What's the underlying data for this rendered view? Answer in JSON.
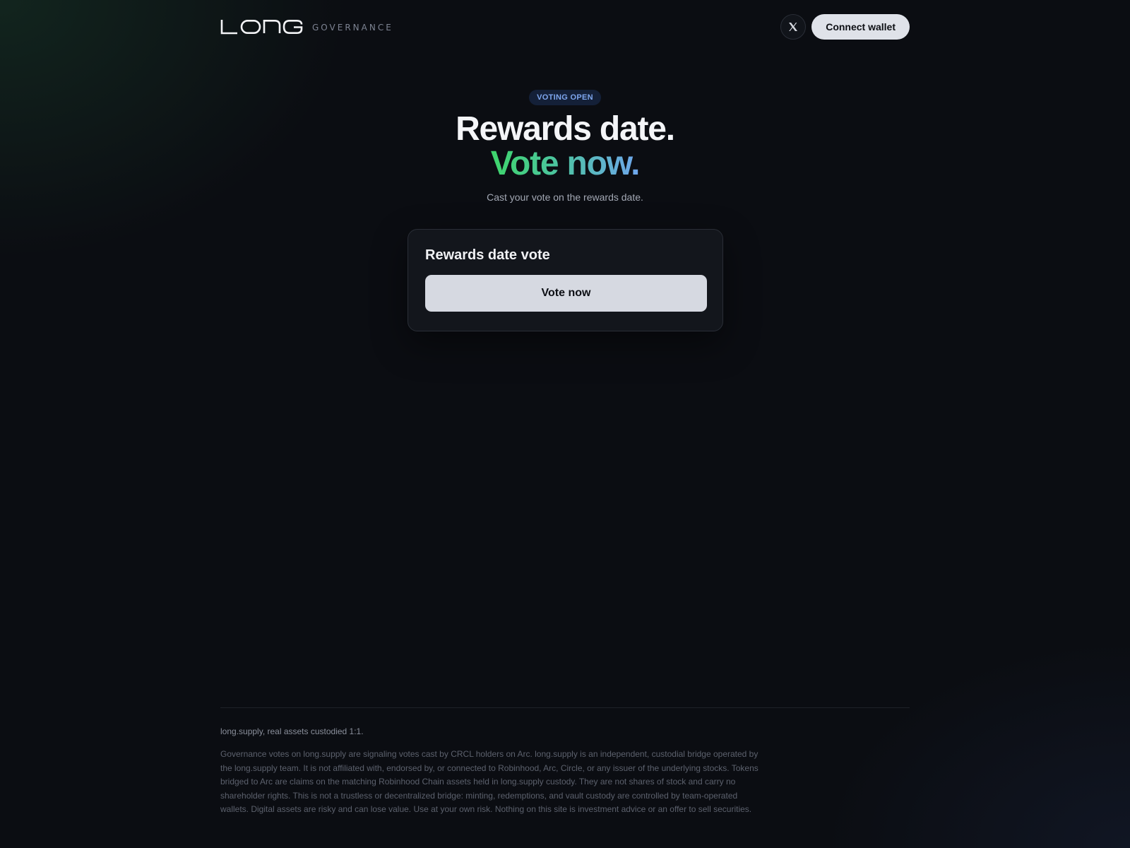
{
  "header": {
    "logo_text": "LONG",
    "brand_subtitle": "GOVERNANCE",
    "social_icon": "x-logo-icon",
    "connect_label": "Connect wallet"
  },
  "hero": {
    "status_badge": "VOTING OPEN",
    "title_line1": "Rewards date.",
    "title_line2": "Vote now.",
    "subtitle": "Cast your vote on the rewards date."
  },
  "vote_card": {
    "title": "Rewards date vote",
    "button_label": "Vote now"
  },
  "footer": {
    "tagline": "long.supply, real assets custodied 1:1.",
    "disclaimer": "Governance votes on long.supply are signaling votes cast by CRCL holders on Arc. long.supply is an independent, custodial bridge operated by the long.supply team. It is not affiliated with, endorsed by, or connected to Robinhood, Arc, Circle, or any issuer of the underlying stocks. Tokens bridged to Arc are claims on the matching Robinhood Chain assets held in long.supply custody. They are not shares of stock and carry no shareholder rights. This is not a trustless or decentralized bridge: minting, redemptions, and vault custody are controlled by team-operated wallets. Digital assets are risky and can lose value. Use at your own risk. Nothing on this site is investment advice or an offer to sell securities."
  },
  "colors": {
    "background": "#0b0d12",
    "accent_green": "#3ed56b",
    "accent_blue": "#6fa6ee",
    "badge_text": "#7ea6ee",
    "button_light": "#dfe2e9"
  }
}
